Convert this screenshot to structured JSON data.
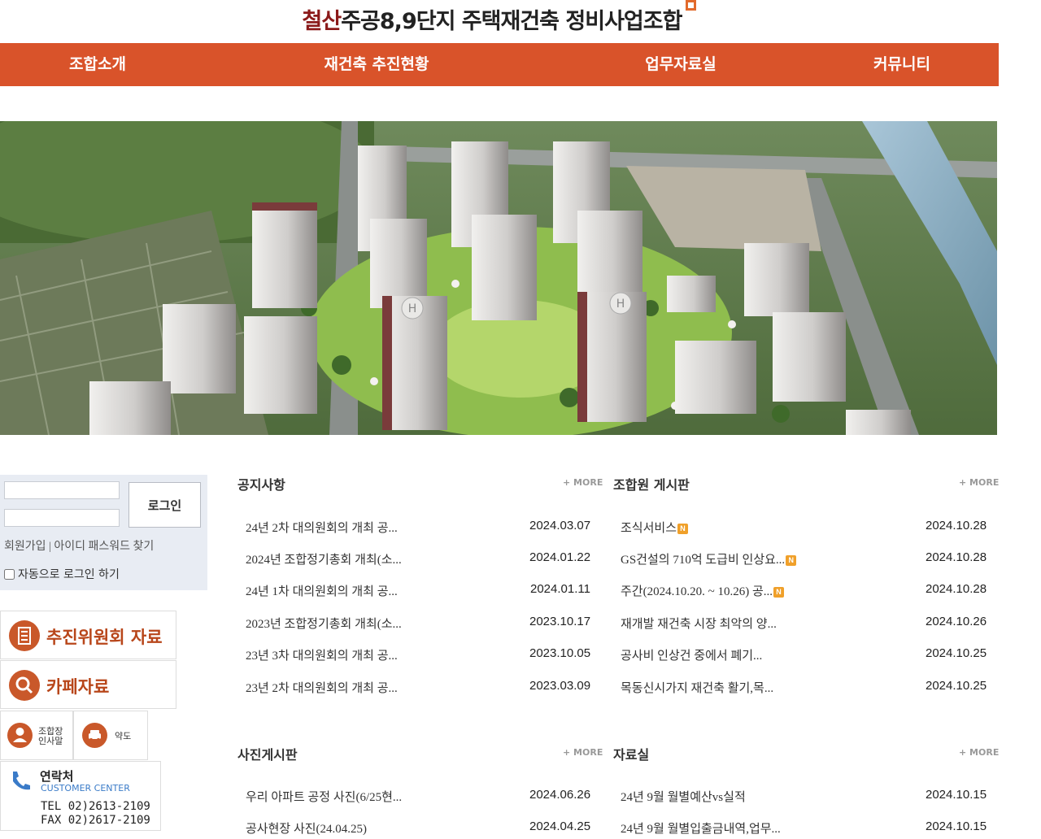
{
  "header": {
    "title_accent": "철산",
    "title_rest": "주공8,9단지 주택재건축 정비사업조합"
  },
  "nav": {
    "items": [
      {
        "label": "조합소개"
      },
      {
        "label": "재건축 추진현황"
      },
      {
        "label": "업무자료실"
      },
      {
        "label": "커뮤니티"
      }
    ]
  },
  "login": {
    "button_label": "로그인",
    "signup_link": "회원가입",
    "find_link": "아이디 패스워드 찾기",
    "separator": "|",
    "auto_login_label": "자동으로 로그인 하기"
  },
  "sidebar": {
    "committee_label": "추진위원회 자료",
    "cafe_label": "카페자료",
    "greeting_label_1": "조합장",
    "greeting_label_2": "인사말",
    "map_label": "약도",
    "contact": {
      "title": "연락처",
      "subtitle": "CUSTOMER CENTER",
      "tel": "TEL  02)2613-2109",
      "fax": "FAX 02)2617-2109"
    }
  },
  "boards": {
    "more_label": "+ MORE",
    "notice": {
      "title": "공지사항",
      "rows": [
        {
          "title": "24년 2차 대의원회의 개최 공...",
          "date": "2024.03.07"
        },
        {
          "title": "2024년 조합정기총회 개최(소...",
          "date": "2024.01.22"
        },
        {
          "title": "24년 1차 대의원회의 개최 공...",
          "date": "2024.01.11"
        },
        {
          "title": "2023년 조합정기총회 개최(소...",
          "date": "2023.10.17"
        },
        {
          "title": "23년 3차 대의원회의 개최 공...",
          "date": "2023.10.05"
        },
        {
          "title": "23년 2차 대의원회의 개최 공...",
          "date": "2023.03.09"
        }
      ]
    },
    "member": {
      "title": "조합원 게시판",
      "new_badge": "N",
      "rows": [
        {
          "title": "조식서비스",
          "date": "2024.10.28"
        },
        {
          "title": "GS건설의 710억 도급비 인상요...",
          "date": "2024.10.28"
        },
        {
          "title": "주간(2024.10.20. ~ 10.26) 공...",
          "date": "2024.10.28"
        },
        {
          "title": "재개발 재건축 시장 최악의 양...",
          "date": "2024.10.26"
        },
        {
          "title": "공사비 인상건 중에서 폐기...",
          "date": "2024.10.25"
        },
        {
          "title": "목동신시가지 재건축 활기,목...",
          "date": "2024.10.25"
        }
      ]
    },
    "photo": {
      "title": "사진게시판",
      "rows": [
        {
          "title": "우리 아파트 공정 사진(6/25현...",
          "date": "2024.06.26"
        },
        {
          "title": "공사현장 사진(24.04.25)",
          "date": "2024.04.25"
        }
      ]
    },
    "data": {
      "title": "자료실",
      "rows": [
        {
          "title": "24년 9월 월별예산vs실적",
          "date": "2024.10.15"
        },
        {
          "title": "24년 9월 월별입출금내역,업무...",
          "date": "2024.10.15"
        }
      ]
    }
  }
}
